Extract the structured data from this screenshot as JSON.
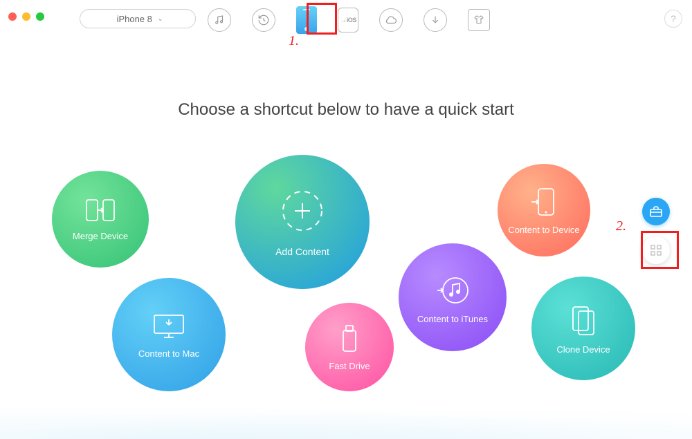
{
  "window": {
    "device_selected": "iPhone 8"
  },
  "annotations": {
    "step1": "1.",
    "step2": "2."
  },
  "nav": {
    "items": [
      {
        "name": "music-library-icon"
      },
      {
        "name": "history-icon"
      },
      {
        "name": "device-phone-icon",
        "active": true
      },
      {
        "name": "to-ios-icon",
        "text": "iOS"
      },
      {
        "name": "icloud-icon"
      },
      {
        "name": "download-icon"
      },
      {
        "name": "tshirt-icon"
      }
    ],
    "help_label": "?"
  },
  "headline": "Choose a shortcut below to have a quick start",
  "shortcuts": {
    "merge_device": {
      "label": "Merge Device"
    },
    "content_to_mac": {
      "label": "Content to Mac"
    },
    "add_content": {
      "label": "Add Content"
    },
    "fast_drive": {
      "label": "Fast Drive"
    },
    "content_to_itunes": {
      "label": "Content to iTunes"
    },
    "content_to_device": {
      "label": "Content to Device"
    },
    "clone_device": {
      "label": "Clone Device"
    }
  },
  "side": {
    "toolbox": "toolbox",
    "grid": "category-grid"
  }
}
